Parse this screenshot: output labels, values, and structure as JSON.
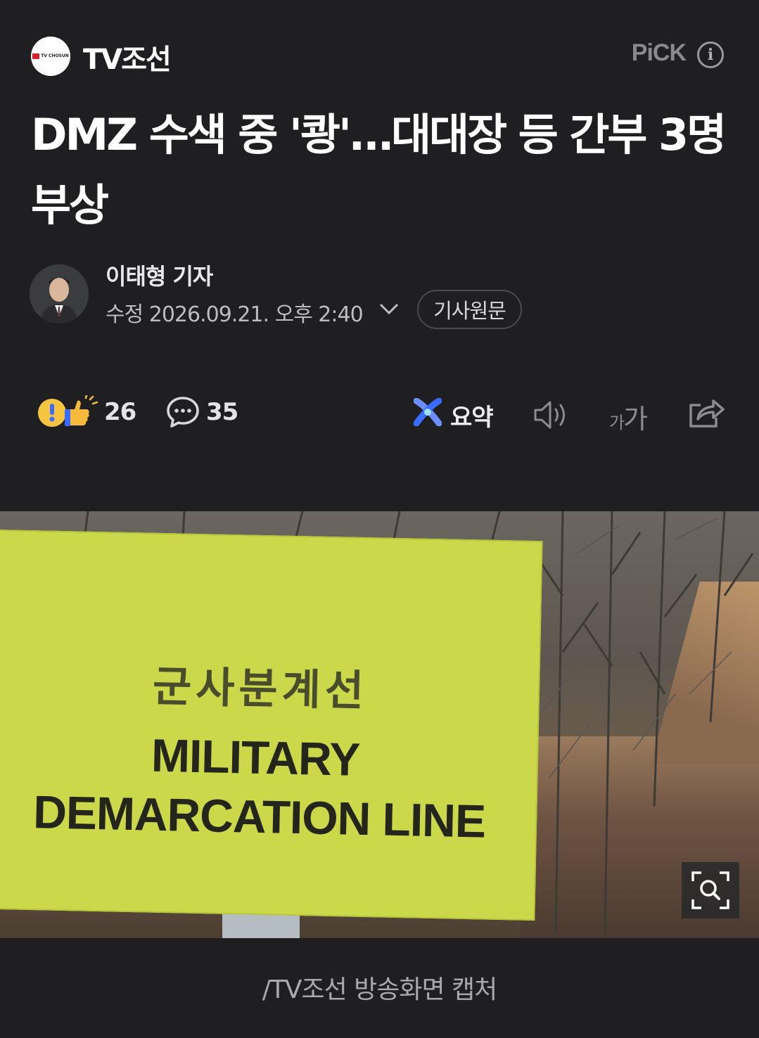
{
  "header": {
    "press_name": "TV조선",
    "logo_text": "TV CHOSUN",
    "pick_label": "PiCK",
    "info_icon": "info-icon"
  },
  "article": {
    "headline": "DMZ 수색 중 '쾅'…대대장 등 간부 3명 부상",
    "reporter": "이태형 기자",
    "datetime": "수정 2026.09.21. 오후 2:40",
    "original_button": "기사원문"
  },
  "actions": {
    "reaction_count": "26",
    "comment_count": "35",
    "summary_label": "요약",
    "font_small": "가",
    "font_big": "가"
  },
  "photo": {
    "sign_korean": "군사분계선",
    "sign_line1": "MILITARY",
    "sign_line2": "DEMARCATION LINE",
    "caption": "/TV조선 방송화면 캡처"
  },
  "colors": {
    "background": "#1f1f21",
    "sign": "#cbd84a",
    "summary_accent": "#3b6cff"
  }
}
